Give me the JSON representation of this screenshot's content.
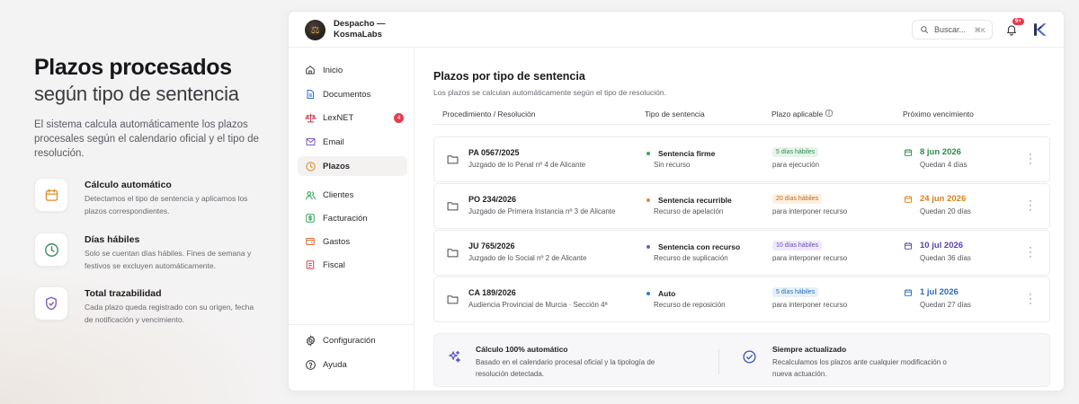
{
  "hero": {
    "title": "Plazos procesados",
    "subtitle": "según tipo de sentencia",
    "description": "El sistema calcula automáticamente los plazos procesales según el calendario oficial y el tipo de resolución."
  },
  "features": [
    {
      "icon": "calendar-icon",
      "title": "Cálculo automático",
      "desc": "Detectamos el tipo de sentencia y aplicamos los plazos correspondientes."
    },
    {
      "icon": "clock-icon",
      "title": "Días hábiles",
      "desc": "Solo se cuentan días hábiles. Fines de semana y festivos se excluyen automáticamente."
    },
    {
      "icon": "shield-check-icon",
      "title": "Total trazabilidad",
      "desc": "Cada plazo queda registrado con su origen, fecha de notificación y vencimiento."
    }
  ],
  "topbar": {
    "org_name": "Despacho — KosmaLabs",
    "search_placeholder": "Buscar...",
    "search_shortcut": "⌘K",
    "notification_count": "9+"
  },
  "sidebar": {
    "items": [
      {
        "label": "Inicio",
        "icon": "home-icon"
      },
      {
        "label": "Documentos",
        "icon": "document-icon"
      },
      {
        "label": "LexNET",
        "icon": "scale-icon",
        "badge": "4"
      },
      {
        "label": "Email",
        "icon": "mail-icon"
      },
      {
        "label": "Plazos",
        "icon": "clock-icon",
        "active": true
      },
      {
        "label": "Clientes",
        "icon": "users-icon"
      },
      {
        "label": "Facturación",
        "icon": "dollar-icon"
      },
      {
        "label": "Gastos",
        "icon": "wallet-icon"
      },
      {
        "label": "Fiscal",
        "icon": "fiscal-icon"
      }
    ],
    "footer": [
      {
        "label": "Configuración",
        "icon": "gear-icon"
      },
      {
        "label": "Ayuda",
        "icon": "help-icon"
      }
    ]
  },
  "main": {
    "title": "Plazos por tipo de sentencia",
    "subtitle": "Los plazos se calculan automáticamente según el tipo de resolución.",
    "columns": [
      "Procedimiento / Resolución",
      "Tipo de sentencia",
      "Plazo aplicable",
      "Próximo vencimiento"
    ],
    "rows": [
      {
        "proc": "PA 0567/2025",
        "court": "Juzgado de lo Penal nº 4 de Alicante",
        "type": "Sentencia firme",
        "resource": "Sin recurso",
        "dot_color": "#3aa55d",
        "plazo": "5 días hábiles",
        "plazo_note": "para ejecución",
        "badge_bg": "#e6f4ea",
        "badge_fg": "#2f8a4e",
        "date": "8 jun 2026",
        "date_color": "#2f8a4e",
        "remaining": "Quedan 4 días"
      },
      {
        "proc": "PO 234/2026",
        "court": "Juzgado de Primera Instancia nº 3 de Alicante",
        "type": "Sentencia recurrible",
        "resource": "Recurso de apelación",
        "dot_color": "#e28a2b",
        "plazo": "20 días hábiles",
        "plazo_note": "para interponer recurso",
        "badge_bg": "#fdf0e0",
        "badge_fg": "#b86a17",
        "date": "24 jun 2026",
        "date_color": "#d9821f",
        "remaining": "Quedan 20 días"
      },
      {
        "proc": "JU 765/2026",
        "court": "Juzgado de lo Social nº 2 de Alicante",
        "type": "Sentencia con recurso",
        "resource": "Recurso de suplicación",
        "dot_color": "#7a58c9",
        "plazo": "10 días hábiles",
        "plazo_note": "para interponer recurso",
        "badge_bg": "#efe9fb",
        "badge_fg": "#6a4cbf",
        "date": "10 jul 2026",
        "date_color": "#5b3fb0",
        "remaining": "Quedan 36 días"
      },
      {
        "proc": "CA 189/2026",
        "court": "Audiencia Provincial de Murcia · Sección 4ª",
        "type": "Auto",
        "resource": "Recurso de reposición",
        "dot_color": "#2f7bd0",
        "plazo": "5 días hábiles",
        "plazo_note": "para interponer recurso",
        "badge_bg": "#e6f0fb",
        "badge_fg": "#2a6cb8",
        "date": "1 jul 2026",
        "date_color": "#2a6cb8",
        "remaining": "Quedan 27 días"
      }
    ]
  },
  "info": [
    {
      "icon": "sparkles-icon",
      "title": "Cálculo 100% automático",
      "desc": "Basado en el calendario procesal oficial y la tipología de resolución detectada."
    },
    {
      "icon": "check-circle-icon",
      "title": "Siempre actualizado",
      "desc": "Recalculamos los plazos ante cualquier modificación o nueva actuación."
    }
  ]
}
